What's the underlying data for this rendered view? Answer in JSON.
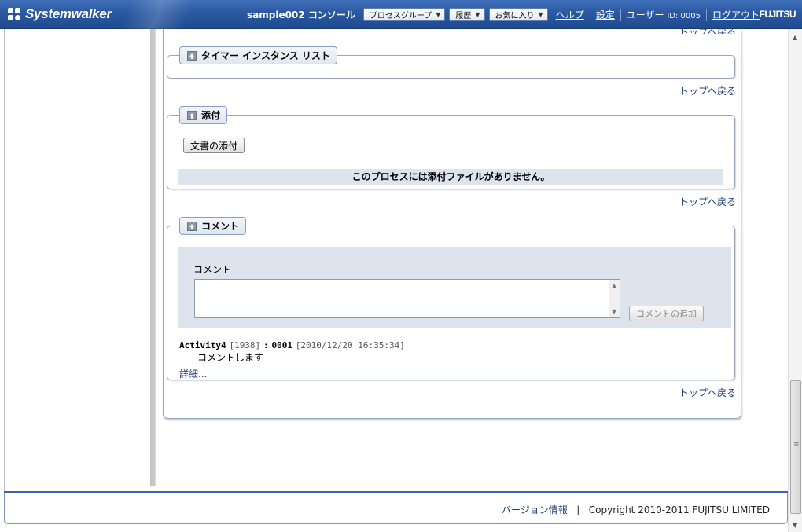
{
  "header": {
    "app_name": "Systemwalker",
    "console_title": "sample002 コンソール",
    "dropdowns": [
      {
        "label": "プロセスグループ"
      },
      {
        "label": "履歴"
      },
      {
        "label": "お気に入り"
      }
    ],
    "help_link": "ヘルプ",
    "settings_link": "設定",
    "user_label": "ユーザー",
    "user_id": "ID: 0005",
    "logout_link": "ログアウト",
    "brand": "FUJITSU"
  },
  "top_link_partial": "トップへ戻る",
  "sections": {
    "timer": {
      "title": "タイマー インスタンス リスト",
      "to_top": "トップへ戻る"
    },
    "attachments": {
      "title": "添付",
      "attach_button": "文書の添付",
      "empty_message": "このプロセスには添付ファイルがありません。",
      "to_top": "トップへ戻る"
    },
    "comments": {
      "title": "コメント",
      "comment_label": "コメント",
      "comment_value": "",
      "add_button": "コメントの追加",
      "entries": [
        {
          "activity": "Activity4",
          "activity_id": "[1938]",
          "separator": ":",
          "user": "0001",
          "timestamp": "[2010/12/20 16:35:34]",
          "text": "コメントします"
        }
      ],
      "details_link": "詳細...",
      "to_top": "トップへ戻る"
    }
  },
  "footer": {
    "version_link": "バージョン情報",
    "divider": "|",
    "copyright": "Copyright 2010-2011 FUJITSU LIMITED"
  },
  "icons": {
    "up": "up-arrow-icon",
    "caret": "chevron-down-icon"
  },
  "colors": {
    "header_blue": "#2b58a0",
    "panel_bg": "#dde4ee",
    "link": "#1f3f77"
  }
}
